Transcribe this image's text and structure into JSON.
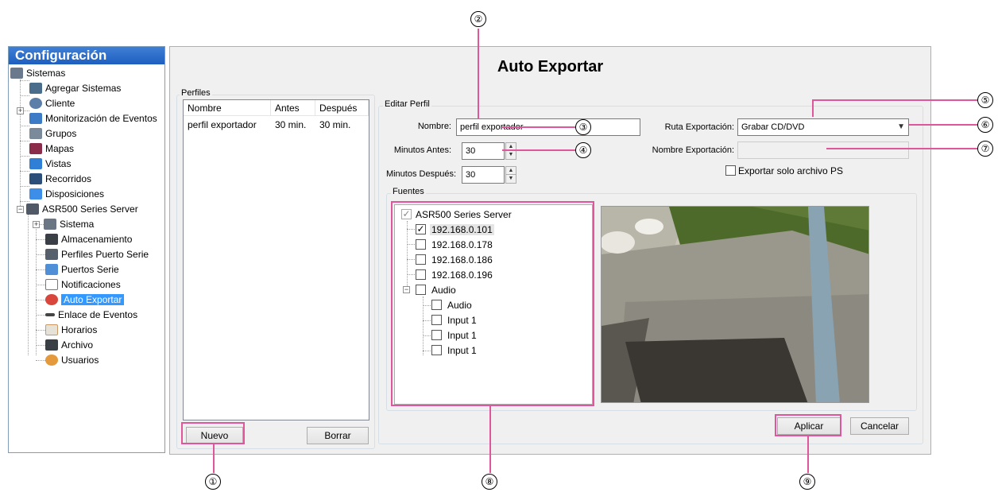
{
  "sidebar": {
    "title": "Configuración",
    "items": [
      {
        "label": "Sistemas",
        "icon": "server-icon"
      },
      {
        "label": "Agregar Sistemas",
        "icon": "add-system-icon"
      },
      {
        "label": "Cliente",
        "icon": "gear-icon"
      },
      {
        "label": "Monitorización de Eventos",
        "icon": "event-monitor-icon"
      },
      {
        "label": "Grupos",
        "icon": "groups-icon"
      },
      {
        "label": "Mapas",
        "icon": "map-icon"
      },
      {
        "label": "Vistas",
        "icon": "views-icon"
      },
      {
        "label": "Recorridos",
        "icon": "tours-icon"
      },
      {
        "label": "Disposiciones",
        "icon": "layouts-icon"
      },
      {
        "label": "ASR500 Series Server",
        "icon": "server-icon"
      },
      {
        "label": "Sistema",
        "icon": "system-icon"
      },
      {
        "label": "Almacenamiento",
        "icon": "storage-icon"
      },
      {
        "label": "Perfiles Puerto Serie",
        "icon": "serial-profile-icon"
      },
      {
        "label": "Puertos Serie",
        "icon": "serial-port-icon"
      },
      {
        "label": "Notificaciones",
        "icon": "envelope-icon"
      },
      {
        "label": "Auto Exportar",
        "icon": "auto-export-icon"
      },
      {
        "label": "Enlace de Eventos",
        "icon": "link-icon"
      },
      {
        "label": "Horarios",
        "icon": "calendar-icon"
      },
      {
        "label": "Archivo",
        "icon": "archive-icon"
      },
      {
        "label": "Usuarios",
        "icon": "users-icon"
      }
    ]
  },
  "main": {
    "title": "Auto Exportar",
    "profiles": {
      "group_label": "Perfiles",
      "columns": [
        "Nombre",
        "Antes",
        "Después"
      ],
      "rows": [
        [
          "perfil exportador",
          "30 min.",
          "30 min."
        ]
      ],
      "new_button": "Nuevo",
      "delete_button": "Borrar"
    },
    "edit": {
      "group_label": "Editar Perfil",
      "name_label": "Nombre:",
      "name_value": "perfil exportador",
      "minutes_before_label": "Minutos Antes:",
      "minutes_before_value": "30",
      "minutes_after_label": "Minutos Después:",
      "minutes_after_value": "30",
      "export_path_label": "Ruta Exportación:",
      "export_path_value": "Grabar CD/DVD",
      "export_name_label": "Nombre Exportación:",
      "export_name_value": "",
      "ps_only_label": "Exportar solo archivo PS",
      "ps_only_checked": false
    },
    "sources": {
      "group_label": "Fuentes",
      "tree": [
        {
          "label": "ASR500 Series Server",
          "checked": true
        },
        {
          "label": "192.168.0.101",
          "checked": true
        },
        {
          "label": "192.168.0.178",
          "checked": false
        },
        {
          "label": "192.168.0.186",
          "checked": false
        },
        {
          "label": "192.168.0.196",
          "checked": false
        },
        {
          "label": "Audio",
          "checked": false
        },
        {
          "label": "Audio",
          "checked": false
        },
        {
          "label": "Input 1",
          "checked": false
        },
        {
          "label": "Input 1",
          "checked": false
        },
        {
          "label": "Input 1",
          "checked": false
        }
      ]
    },
    "apply_button": "Aplicar",
    "cancel_button": "Cancelar"
  },
  "callouts": [
    "①",
    "②",
    "③",
    "④",
    "⑤",
    "⑥",
    "⑦",
    "⑧",
    "⑨"
  ],
  "colors": {
    "accent": "#e0569a",
    "header": "#1e5fbf",
    "selection": "#3399ff"
  }
}
